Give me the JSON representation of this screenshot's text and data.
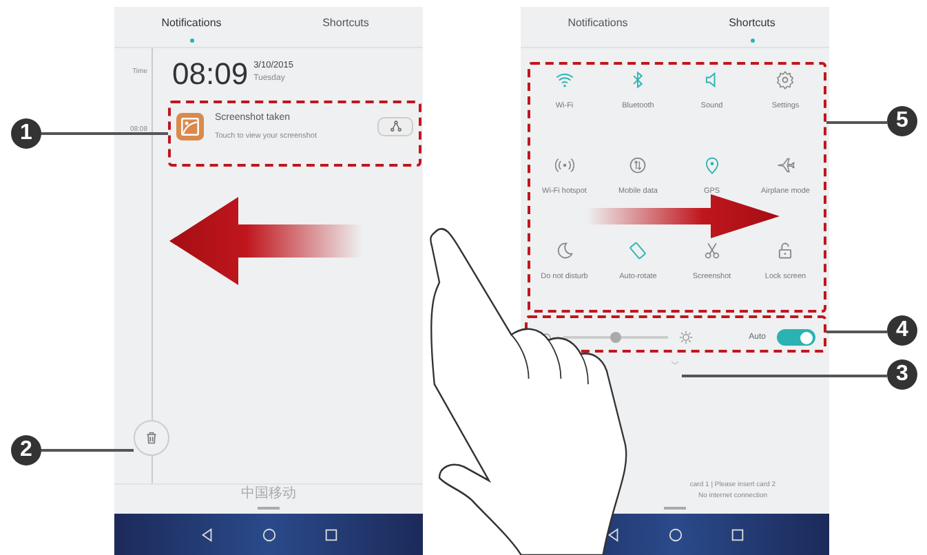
{
  "callouts": [
    {
      "number": "1"
    },
    {
      "number": "2"
    },
    {
      "number": "5"
    },
    {
      "number": "4"
    },
    {
      "number": "3"
    }
  ],
  "notifications_screen": {
    "tabs": [
      {
        "label": "Notifications",
        "selected": true
      },
      {
        "label": "Shortcuts",
        "selected": false
      }
    ],
    "timeline": {
      "time_label": "Time",
      "clock": "08:09",
      "date": "3/10/2015",
      "weekday": "Tuesday",
      "entry_time": "08:08"
    },
    "notification": {
      "title": "Screenshot taken",
      "text": "Touch to view your screenshot"
    },
    "carrier": "中国移动"
  },
  "shortcuts_screen": {
    "tabs": [
      {
        "label": "Notifications",
        "selected": false
      },
      {
        "label": "Shortcuts",
        "selected": true
      }
    ],
    "shortcuts": [
      {
        "label": "Wi-Fi",
        "on": true
      },
      {
        "label": "Bluetooth",
        "on": true
      },
      {
        "label": "Sound",
        "on": true
      },
      {
        "label": "Settings",
        "on": false
      },
      {
        "label": "Wi-Fi hotspot",
        "on": false
      },
      {
        "label": "Mobile data",
        "on": false
      },
      {
        "label": "GPS",
        "on": true
      },
      {
        "label": "Airplane mode",
        "on": false
      },
      {
        "label": "Do not disturb",
        "on": false
      },
      {
        "label": "Auto-rotate",
        "on": true
      },
      {
        "label": "Screenshot",
        "on": false
      },
      {
        "label": "Lock screen",
        "on": false
      }
    ],
    "brightness": {
      "level": 0.5
    },
    "auto_brightness": {
      "label": "Auto",
      "on": true
    },
    "status_lines": [
      "card 1 | Please insert card 2",
      "No internet connection"
    ]
  }
}
